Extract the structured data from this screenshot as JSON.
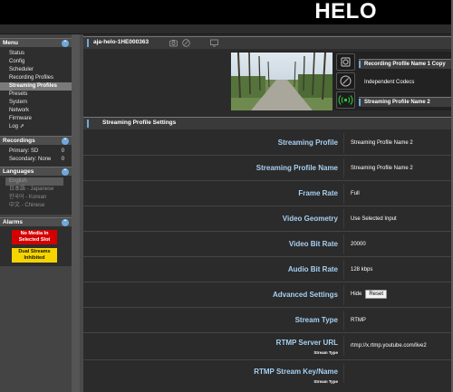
{
  "header": {
    "brand": "HELO"
  },
  "sidebar": {
    "menu": {
      "title": "Menu",
      "items": [
        "Status",
        "Config",
        "Scheduler",
        "Recording Profiles",
        "Streaming Profiles",
        "Presets",
        "System",
        "Network",
        "Firmware",
        "Log ⇗"
      ],
      "active_index": 4
    },
    "recordings": {
      "title": "Recordings",
      "rows": [
        {
          "label": "Primary: SD",
          "value": "0"
        },
        {
          "label": "Secondary: None",
          "value": "0"
        }
      ]
    },
    "languages": {
      "title": "Languages",
      "items": [
        "English",
        "日本語 - Japanese",
        "한국어 - Korean",
        "中文 - Chinese"
      ]
    },
    "alarms": {
      "title": "Alarms",
      "items": [
        {
          "text": "No Media In Selected Slot",
          "color": "#d40000"
        },
        {
          "text": "Dual Streams Inhibited",
          "color": "#f5d400"
        }
      ]
    }
  },
  "main": {
    "device_name": "aja-helo-1HE000363",
    "controls": [
      {
        "label": "Recording Profile Name 1 Copy",
        "icon": "record-icon"
      },
      {
        "label": "Independent Codecs",
        "icon": "link-icon"
      },
      {
        "label": "Streaming Profile Name 2",
        "icon": "stream-icon"
      }
    ],
    "section_title": "Streaming Profile Settings",
    "settings": [
      {
        "label": "Streaming Profile",
        "value": "Streaming Profile Name 2"
      },
      {
        "label": "Streaming Profile Name",
        "value": "Streaming Profile Name 2"
      },
      {
        "label": "Frame Rate",
        "value": "Full"
      },
      {
        "label": "Video Geometry",
        "value": "Use Selected Input"
      },
      {
        "label": "Video Bit Rate",
        "value": "20000"
      },
      {
        "label": "Audio Bit Rate",
        "value": "128 kbps"
      },
      {
        "label": "Advanced Settings",
        "value": "Hide",
        "button": "Reset"
      },
      {
        "label": "Stream Type",
        "value": "RTMP"
      },
      {
        "label": "RTMP Server URL",
        "sub": "Stream Type",
        "value": "rtmp://x.rtmp.youtube.com/live2"
      },
      {
        "label": "RTMP Stream Key/Name",
        "sub": "Stream Type",
        "value": ""
      }
    ]
  },
  "colors": {
    "accent": "#6fa8dc",
    "label_blue": "#a7d0f2",
    "stream_green": "#2ecc40"
  }
}
